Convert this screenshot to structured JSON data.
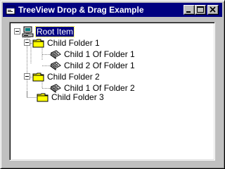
{
  "window": {
    "title": "TreeView Drop & Drag Example",
    "controls": [
      "minimize",
      "maximize",
      "close"
    ]
  },
  "tree": {
    "root": {
      "label": "Root Item",
      "icon": "computer-icon",
      "expanded": true,
      "selected": true
    },
    "folders": [
      {
        "label": "Child Folder 1",
        "icon": "folder-icon",
        "expanded": true,
        "children": [
          {
            "label": "Child 1 Of Folder 1",
            "icon": "document-icon"
          },
          {
            "label": "Child 2 Of Folder 1",
            "icon": "document-icon"
          }
        ]
      },
      {
        "label": "Child Folder 2",
        "icon": "folder-icon",
        "expanded": true,
        "children": [
          {
            "label": "Child 1 Of Folder 2",
            "icon": "document-icon"
          }
        ]
      },
      {
        "label": "Child Folder 3",
        "icon": "folder-icon",
        "expanded": false,
        "children": []
      }
    ]
  },
  "colors": {
    "titlebar": "#000080",
    "folder": "#ffff00",
    "selection": "#000080"
  }
}
